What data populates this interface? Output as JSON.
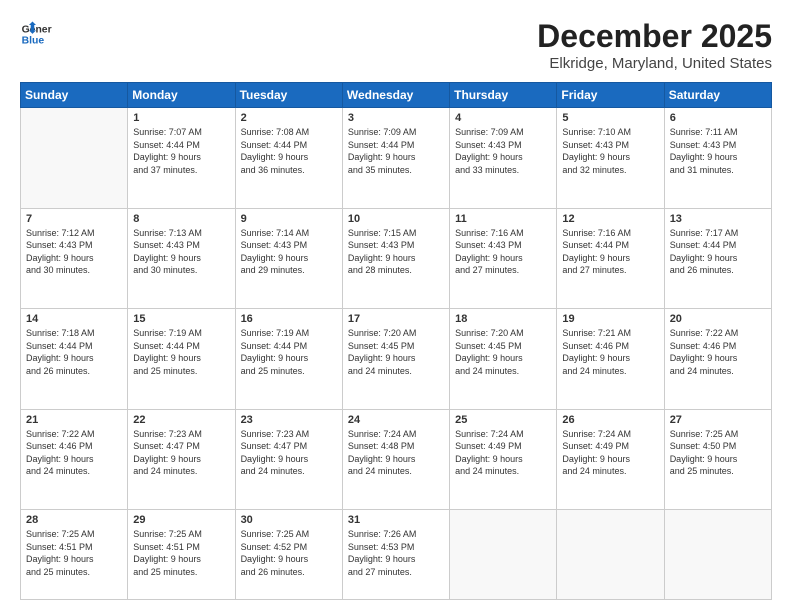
{
  "header": {
    "logo": {
      "line1": "General",
      "line2": "Blue"
    },
    "title": "December 2025",
    "subtitle": "Elkridge, Maryland, United States"
  },
  "weekdays": [
    "Sunday",
    "Monday",
    "Tuesday",
    "Wednesday",
    "Thursday",
    "Friday",
    "Saturday"
  ],
  "weeks": [
    [
      {
        "day": "",
        "info": ""
      },
      {
        "day": "1",
        "info": "Sunrise: 7:07 AM\nSunset: 4:44 PM\nDaylight: 9 hours\nand 37 minutes."
      },
      {
        "day": "2",
        "info": "Sunrise: 7:08 AM\nSunset: 4:44 PM\nDaylight: 9 hours\nand 36 minutes."
      },
      {
        "day": "3",
        "info": "Sunrise: 7:09 AM\nSunset: 4:44 PM\nDaylight: 9 hours\nand 35 minutes."
      },
      {
        "day": "4",
        "info": "Sunrise: 7:09 AM\nSunset: 4:43 PM\nDaylight: 9 hours\nand 33 minutes."
      },
      {
        "day": "5",
        "info": "Sunrise: 7:10 AM\nSunset: 4:43 PM\nDaylight: 9 hours\nand 32 minutes."
      },
      {
        "day": "6",
        "info": "Sunrise: 7:11 AM\nSunset: 4:43 PM\nDaylight: 9 hours\nand 31 minutes."
      }
    ],
    [
      {
        "day": "7",
        "info": "Sunrise: 7:12 AM\nSunset: 4:43 PM\nDaylight: 9 hours\nand 30 minutes."
      },
      {
        "day": "8",
        "info": "Sunrise: 7:13 AM\nSunset: 4:43 PM\nDaylight: 9 hours\nand 30 minutes."
      },
      {
        "day": "9",
        "info": "Sunrise: 7:14 AM\nSunset: 4:43 PM\nDaylight: 9 hours\nand 29 minutes."
      },
      {
        "day": "10",
        "info": "Sunrise: 7:15 AM\nSunset: 4:43 PM\nDaylight: 9 hours\nand 28 minutes."
      },
      {
        "day": "11",
        "info": "Sunrise: 7:16 AM\nSunset: 4:43 PM\nDaylight: 9 hours\nand 27 minutes."
      },
      {
        "day": "12",
        "info": "Sunrise: 7:16 AM\nSunset: 4:44 PM\nDaylight: 9 hours\nand 27 minutes."
      },
      {
        "day": "13",
        "info": "Sunrise: 7:17 AM\nSunset: 4:44 PM\nDaylight: 9 hours\nand 26 minutes."
      }
    ],
    [
      {
        "day": "14",
        "info": "Sunrise: 7:18 AM\nSunset: 4:44 PM\nDaylight: 9 hours\nand 26 minutes."
      },
      {
        "day": "15",
        "info": "Sunrise: 7:19 AM\nSunset: 4:44 PM\nDaylight: 9 hours\nand 25 minutes."
      },
      {
        "day": "16",
        "info": "Sunrise: 7:19 AM\nSunset: 4:44 PM\nDaylight: 9 hours\nand 25 minutes."
      },
      {
        "day": "17",
        "info": "Sunrise: 7:20 AM\nSunset: 4:45 PM\nDaylight: 9 hours\nand 24 minutes."
      },
      {
        "day": "18",
        "info": "Sunrise: 7:20 AM\nSunset: 4:45 PM\nDaylight: 9 hours\nand 24 minutes."
      },
      {
        "day": "19",
        "info": "Sunrise: 7:21 AM\nSunset: 4:46 PM\nDaylight: 9 hours\nand 24 minutes."
      },
      {
        "day": "20",
        "info": "Sunrise: 7:22 AM\nSunset: 4:46 PM\nDaylight: 9 hours\nand 24 minutes."
      }
    ],
    [
      {
        "day": "21",
        "info": "Sunrise: 7:22 AM\nSunset: 4:46 PM\nDaylight: 9 hours\nand 24 minutes."
      },
      {
        "day": "22",
        "info": "Sunrise: 7:23 AM\nSunset: 4:47 PM\nDaylight: 9 hours\nand 24 minutes."
      },
      {
        "day": "23",
        "info": "Sunrise: 7:23 AM\nSunset: 4:47 PM\nDaylight: 9 hours\nand 24 minutes."
      },
      {
        "day": "24",
        "info": "Sunrise: 7:24 AM\nSunset: 4:48 PM\nDaylight: 9 hours\nand 24 minutes."
      },
      {
        "day": "25",
        "info": "Sunrise: 7:24 AM\nSunset: 4:49 PM\nDaylight: 9 hours\nand 24 minutes."
      },
      {
        "day": "26",
        "info": "Sunrise: 7:24 AM\nSunset: 4:49 PM\nDaylight: 9 hours\nand 24 minutes."
      },
      {
        "day": "27",
        "info": "Sunrise: 7:25 AM\nSunset: 4:50 PM\nDaylight: 9 hours\nand 25 minutes."
      }
    ],
    [
      {
        "day": "28",
        "info": "Sunrise: 7:25 AM\nSunset: 4:51 PM\nDaylight: 9 hours\nand 25 minutes."
      },
      {
        "day": "29",
        "info": "Sunrise: 7:25 AM\nSunset: 4:51 PM\nDaylight: 9 hours\nand 25 minutes."
      },
      {
        "day": "30",
        "info": "Sunrise: 7:25 AM\nSunset: 4:52 PM\nDaylight: 9 hours\nand 26 minutes."
      },
      {
        "day": "31",
        "info": "Sunrise: 7:26 AM\nSunset: 4:53 PM\nDaylight: 9 hours\nand 27 minutes."
      },
      {
        "day": "",
        "info": ""
      },
      {
        "day": "",
        "info": ""
      },
      {
        "day": "",
        "info": ""
      }
    ]
  ]
}
